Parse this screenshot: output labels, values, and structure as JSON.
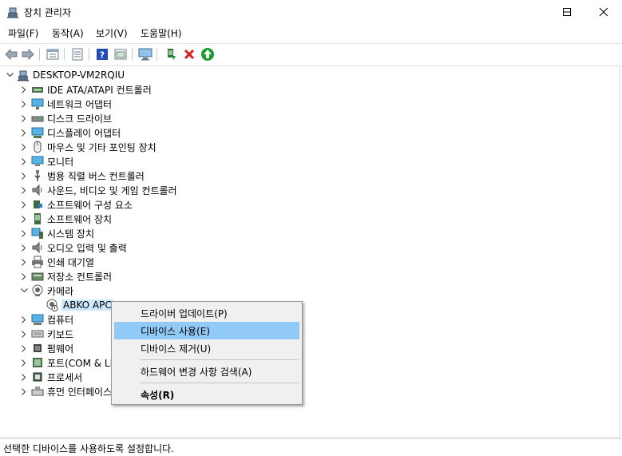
{
  "window": {
    "title": "장치 관리자",
    "controls": {
      "minimize": "minimize",
      "maximize": "maximize",
      "close": "close"
    }
  },
  "menu": [
    {
      "label": "파일(F)"
    },
    {
      "label": "동작(A)"
    },
    {
      "label": "보기(V)"
    },
    {
      "label": "도움말(H)"
    }
  ],
  "toolbar": {
    "buttons": [
      "back-arrow-icon",
      "forward-arrow-icon",
      "properties-icon",
      "update-list-icon",
      "help-icon",
      "show-hidden-icon",
      "scan-hardware-icon",
      "update-driver-icon",
      "uninstall-icon",
      "enable-device-icon"
    ],
    "colors": {
      "uninstall": "#d81e1e",
      "enable": "#1a9a2c",
      "help": "#1e4bb8"
    }
  },
  "tree": {
    "root": "DESKTOP-VM2RQIU",
    "categories": [
      {
        "label": "IDE ATA/ATAPI 컨트롤러",
        "icon": "ide-controller-icon"
      },
      {
        "label": "네트워크 어댑터",
        "icon": "network-adapter-icon"
      },
      {
        "label": "디스크 드라이브",
        "icon": "disk-drive-icon"
      },
      {
        "label": "디스플레이 어댑터",
        "icon": "display-adapter-icon"
      },
      {
        "label": "마우스 및 기타 포인팅 장치",
        "icon": "mouse-icon"
      },
      {
        "label": "모니터",
        "icon": "monitor-icon"
      },
      {
        "label": "범용 직렬 버스 컨트롤러",
        "icon": "usb-icon"
      },
      {
        "label": "사운드, 비디오 및 게임 컨트롤러",
        "icon": "speaker-icon"
      },
      {
        "label": "소프트웨어 구성 요소",
        "icon": "software-component-icon"
      },
      {
        "label": "소프트웨어 장치",
        "icon": "software-device-icon"
      },
      {
        "label": "시스템 장치",
        "icon": "system-device-icon"
      },
      {
        "label": "오디오 입력 및 출력",
        "icon": "speaker-icon"
      },
      {
        "label": "인쇄 대기열",
        "icon": "printer-icon"
      },
      {
        "label": "저장소 컨트롤러",
        "icon": "storage-controller-icon"
      },
      {
        "label": "카메라",
        "icon": "camera-icon",
        "expanded": true
      },
      {
        "label": "컴퓨터",
        "icon": "computer-icon"
      },
      {
        "label": "키보드",
        "icon": "keyboard-icon"
      },
      {
        "label": "펌웨어",
        "icon": "firmware-icon"
      },
      {
        "label": "포트(COM & LPT)",
        "icon": "port-icon"
      },
      {
        "label": "프로세서",
        "icon": "processor-icon"
      },
      {
        "label": "휴먼 인터페이스 장치",
        "icon": "hid-icon"
      }
    ],
    "camera_child": {
      "label": "ABKO APC",
      "icon": "disabled-webcam-icon"
    }
  },
  "context_menu": {
    "items": [
      {
        "label": "드라이버 업데이트(P)"
      },
      {
        "label": "디바이스 사용(E)",
        "hover": true
      },
      {
        "label": "디바이스 제거(U)"
      },
      {
        "label": "하드웨어 변경 사항 검색(A)"
      },
      {
        "label": "속성(R)",
        "bold": true
      }
    ],
    "hover_color": "#91c9f7"
  },
  "status": {
    "text": "선택한 디바이스를 사용하도록 설정합니다."
  }
}
